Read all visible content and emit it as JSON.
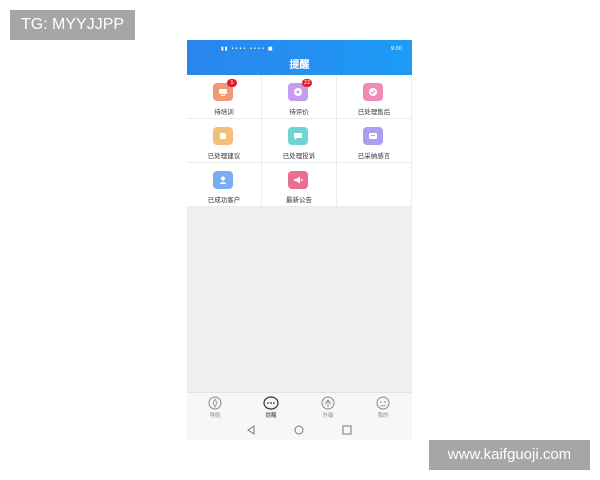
{
  "watermarks": {
    "top_left": "TG: MYYJJPP",
    "bottom_right": "www.kaifguoji.com"
  },
  "status_bar": {
    "left": "▮▮ •••• •••• ■",
    "time": "9:00"
  },
  "header": {
    "title": "提醒"
  },
  "grid": {
    "items": [
      {
        "label": "待培训",
        "badge": "1",
        "color": "#f0987a"
      },
      {
        "label": "待评价",
        "badge": "22",
        "color": "#c29df0"
      },
      {
        "label": "已处理售后",
        "badge": "",
        "color": "#f28ab8"
      },
      {
        "label": "已处理建议",
        "badge": "",
        "color": "#f2c07b"
      },
      {
        "label": "已处理投诉",
        "badge": "",
        "color": "#6fd3d3"
      },
      {
        "label": "已采纳感言",
        "badge": "",
        "color": "#ad9ef0"
      },
      {
        "label": "已成功客户",
        "badge": "",
        "color": "#78aef0"
      },
      {
        "label": "最新公告",
        "badge": "",
        "color": "#ea6f8e"
      }
    ]
  },
  "tabs": [
    {
      "label": "导航",
      "icon": "compass-icon",
      "active": false
    },
    {
      "label": "提醒",
      "icon": "chat-bubble-icon",
      "active": true
    },
    {
      "label": "升级",
      "icon": "upgrade-icon",
      "active": false
    },
    {
      "label": "我的",
      "icon": "profile-icon",
      "active": false
    }
  ],
  "system_nav": [
    "back-icon",
    "home-icon",
    "recents-icon"
  ]
}
